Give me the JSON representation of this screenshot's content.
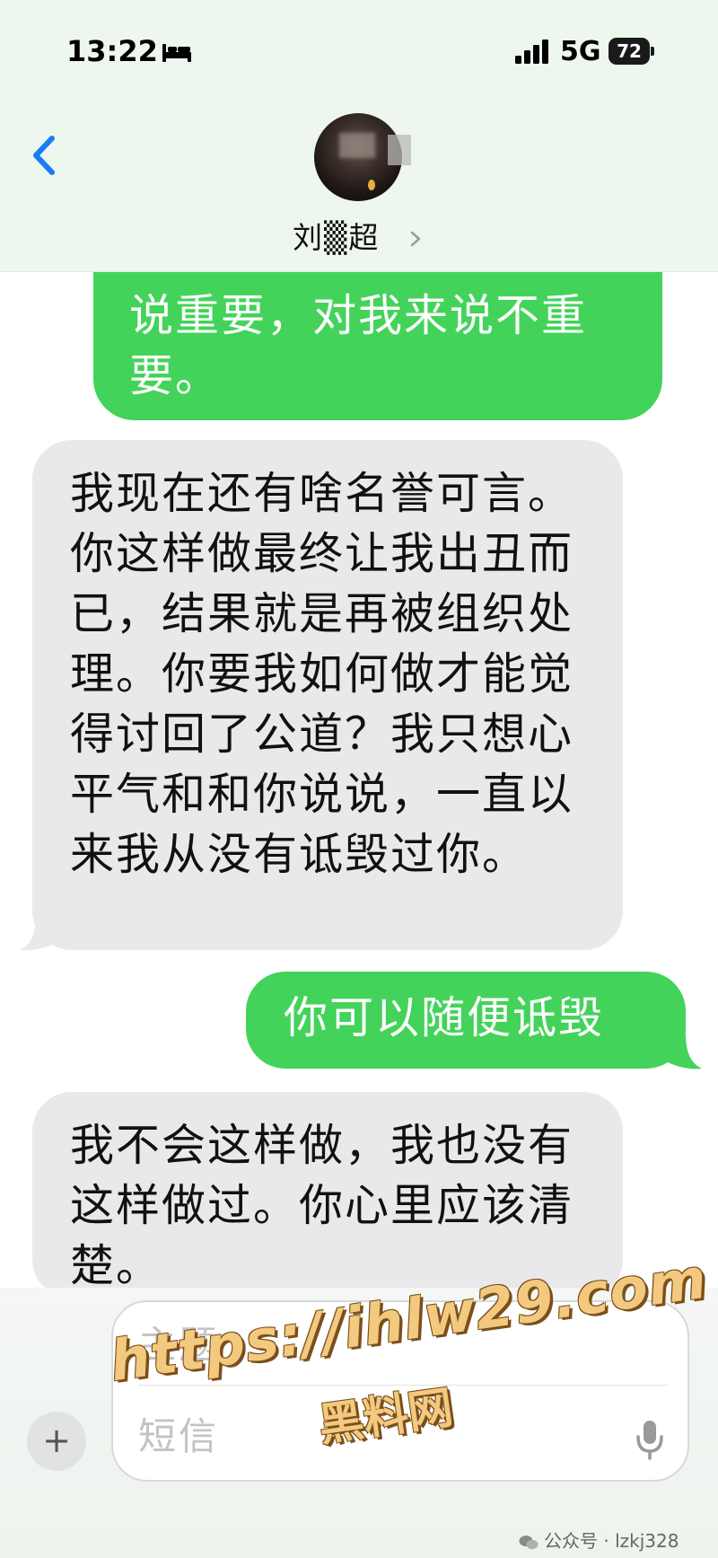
{
  "status_bar": {
    "time": "13:22",
    "network": "5G",
    "battery": "72"
  },
  "header": {
    "contact_name": "刘▒超",
    "icons": [
      "back-chevron-icon",
      "bed-icon",
      "signal-icon",
      "battery-icon",
      "chevron-right-icon"
    ]
  },
  "messages": [
    {
      "direction": "outgoing",
      "text": "说重要，对我来说不重要。"
    },
    {
      "direction": "incoming",
      "text": "我现在还有啥名誉可言。你这样做最终让我出丑而已，结果就是再被组织处理。你要我如何做才能觉得讨回了公道？我只想心平气和和你说说，一直以来我从没有诋毁过你。"
    },
    {
      "direction": "outgoing",
      "text": "你可以随便诋毁"
    },
    {
      "direction": "incoming",
      "text": "我不会这样做，我也没有这样做过。你心里应该清楚。"
    }
  ],
  "composer": {
    "plus": "+",
    "subject_placeholder": "主题",
    "message_placeholder": "短信"
  },
  "watermark": {
    "url": "https://ihlw29.com",
    "subtitle": "黑料网"
  },
  "footer": {
    "credit": "公众号 · lzkj328"
  },
  "colors": {
    "outgoing_bubble": "#43d35a",
    "incoming_bubble": "#e9e9eb",
    "accent": "#1a7cf5"
  }
}
